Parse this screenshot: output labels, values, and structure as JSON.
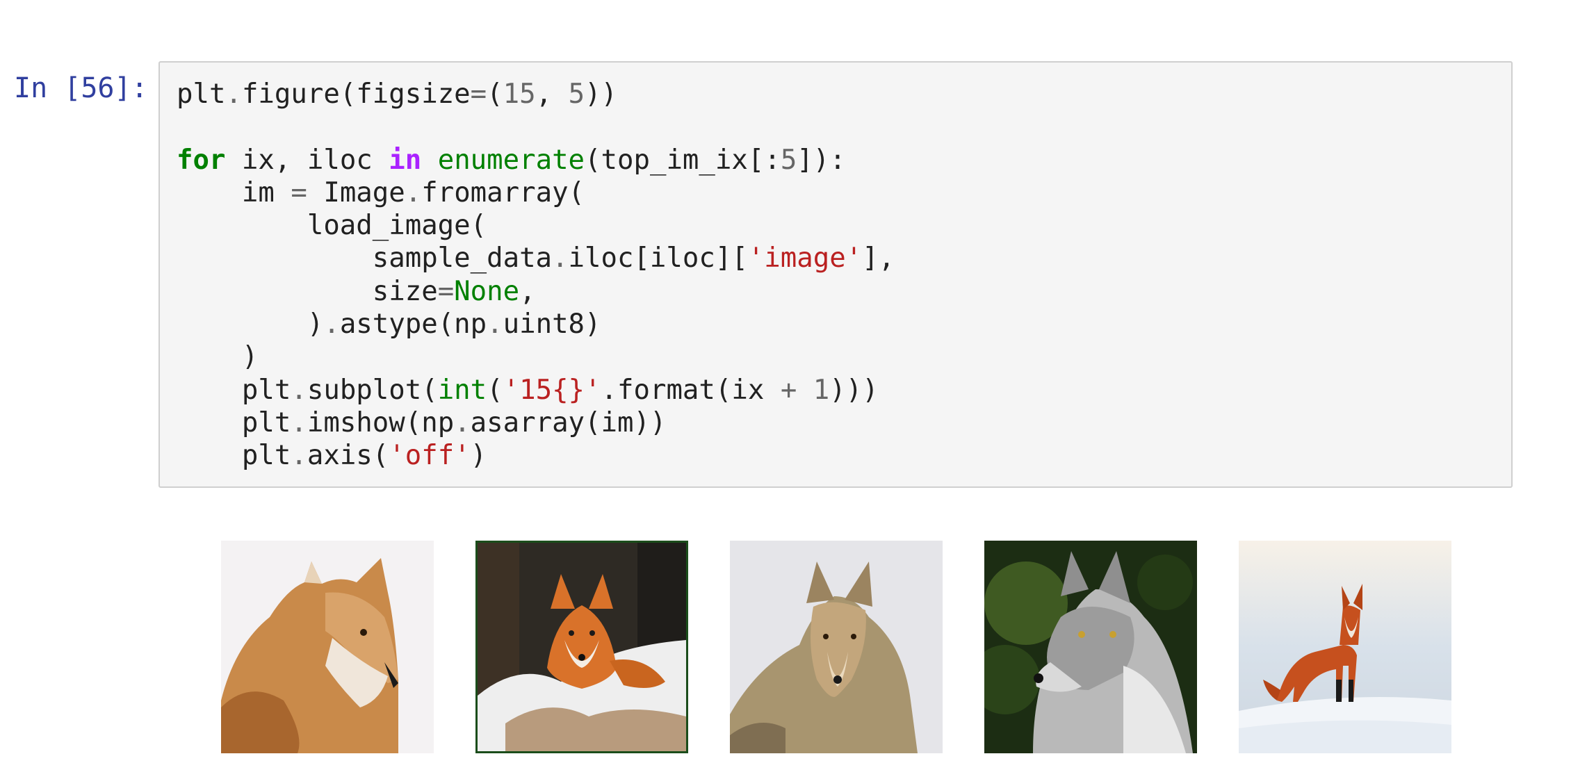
{
  "cell": {
    "prompt": "In [56]:",
    "code_lines": [
      [
        {
          "t": "plt"
        },
        {
          "t": ".",
          "c": "op"
        },
        {
          "t": "figure(figsize"
        },
        {
          "t": "=",
          "c": "op"
        },
        {
          "t": "("
        },
        {
          "t": "15",
          "c": "nu"
        },
        {
          "t": ", "
        },
        {
          "t": "5",
          "c": "nu"
        },
        {
          "t": "))"
        }
      ],
      [],
      [
        {
          "t": "for",
          "c": "kw"
        },
        {
          "t": " ix, iloc "
        },
        {
          "t": "in",
          "c": "ow"
        },
        {
          "t": " "
        },
        {
          "t": "enumerate",
          "c": "bi"
        },
        {
          "t": "(top_im_ix[:"
        },
        {
          "t": "5",
          "c": "nu"
        },
        {
          "t": "]):"
        }
      ],
      [
        {
          "t": "    im "
        },
        {
          "t": "=",
          "c": "op"
        },
        {
          "t": " Image"
        },
        {
          "t": ".",
          "c": "op"
        },
        {
          "t": "fromarray("
        }
      ],
      [
        {
          "t": "        load_image("
        }
      ],
      [
        {
          "t": "            sample_data"
        },
        {
          "t": ".",
          "c": "op"
        },
        {
          "t": "iloc[iloc]["
        },
        {
          "t": "'image'",
          "c": "st"
        },
        {
          "t": "],"
        }
      ],
      [
        {
          "t": "            size"
        },
        {
          "t": "=",
          "c": "op"
        },
        {
          "t": "None",
          "c": "bi"
        },
        {
          "t": ","
        }
      ],
      [
        {
          "t": "        )"
        },
        {
          "t": ".",
          "c": "op"
        },
        {
          "t": "astype(np"
        },
        {
          "t": ".",
          "c": "op"
        },
        {
          "t": "uint8)"
        }
      ],
      [
        {
          "t": "    )"
        }
      ],
      [
        {
          "t": "    plt"
        },
        {
          "t": ".",
          "c": "op"
        },
        {
          "t": "subplot("
        },
        {
          "t": "int",
          "c": "bi"
        },
        {
          "t": "("
        },
        {
          "t": "'15{}'",
          "c": "st"
        },
        {
          "t": "."
        },
        {
          "t": "format(ix "
        },
        {
          "t": "+",
          "c": "op"
        },
        {
          "t": " "
        },
        {
          "t": "1",
          "c": "nu"
        },
        {
          "t": ")))"
        }
      ],
      [
        {
          "t": "    plt"
        },
        {
          "t": ".",
          "c": "op"
        },
        {
          "t": "imshow(np"
        },
        {
          "t": ".",
          "c": "op"
        },
        {
          "t": "asarray(im))"
        }
      ],
      [
        {
          "t": "    plt"
        },
        {
          "t": ".",
          "c": "op"
        },
        {
          "t": "axis("
        },
        {
          "t": "'off'",
          "c": "st"
        },
        {
          "t": ")"
        }
      ]
    ]
  },
  "output": {
    "images": [
      {
        "icon": "red-fox-profile-image",
        "background": "#f3f1f2"
      },
      {
        "icon": "red-fox-in-snow-image",
        "background": "#2d2a24",
        "border": "#1b4d1b"
      },
      {
        "icon": "coyote-in-snow-image",
        "background": "#e6e6ea"
      },
      {
        "icon": "gray-wolf-image",
        "background": "#1f3315"
      },
      {
        "icon": "red-fox-on-snow-hill-image",
        "background": "#e9eef4"
      }
    ]
  }
}
